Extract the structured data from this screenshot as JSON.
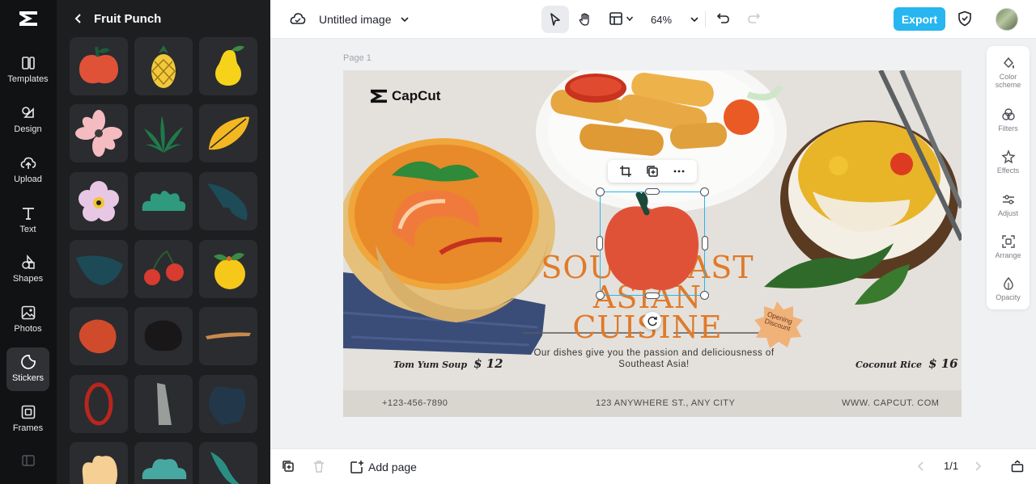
{
  "app": {
    "name": "CapCut"
  },
  "nav": {
    "items": [
      {
        "label": "Templates",
        "icon": "templates-icon",
        "active": false
      },
      {
        "label": "Design",
        "icon": "design-icon",
        "active": false
      },
      {
        "label": "Upload",
        "icon": "upload-icon",
        "active": false
      },
      {
        "label": "Text",
        "icon": "text-icon",
        "active": false
      },
      {
        "label": "Shapes",
        "icon": "shapes-icon",
        "active": false
      },
      {
        "label": "Photos",
        "icon": "photos-icon",
        "active": false
      },
      {
        "label": "Stickers",
        "icon": "stickers-icon",
        "active": true
      },
      {
        "label": "Frames",
        "icon": "frames-icon",
        "active": false
      }
    ]
  },
  "panel": {
    "title": "Fruit Punch",
    "stickers": [
      "apple",
      "pineapple",
      "pear",
      "pink-flower",
      "green-leaves",
      "yellow-leaf",
      "violet-flower",
      "green-bush",
      "teal-leaf",
      "teal-bowl",
      "cherries",
      "lemon",
      "orange-blob",
      "dark-blob",
      "tan-stroke",
      "red-ring",
      "grey-shard",
      "slate-blob",
      "peach-blob",
      "teal-cloud",
      "teal-sprig"
    ]
  },
  "topbar": {
    "doc_title": "Untitled image",
    "zoom": "64%",
    "export_label": "Export",
    "accent": "#27b6ef"
  },
  "canvas": {
    "page_label": "Page 1",
    "design": {
      "brand": "CapCut",
      "headline_line1": "SOUTHEAST ASIAN",
      "headline_line2": "CUISINE",
      "tagline": "Our dishes give you the passion and deliciousness of Southeast Asia!",
      "item1_name": "Tom Yum Soup",
      "item1_price": "$ 12",
      "item2_name": "Coconut Rice",
      "item2_price": "$ 16",
      "badge": "Opening Discount",
      "phone": "+123-456-7890",
      "address": "123 ANYWHERE ST., ANY CITY",
      "website": "WWW. CAPCUT. COM",
      "headline_color": "#e07a2a"
    },
    "selected_sticker": "apple"
  },
  "tools": [
    {
      "label": "Color scheme",
      "icon": "color-scheme-icon"
    },
    {
      "label": "Filters",
      "icon": "filters-icon"
    },
    {
      "label": "Effects",
      "icon": "effects-icon"
    },
    {
      "label": "Adjust",
      "icon": "adjust-icon"
    },
    {
      "label": "Arrange",
      "icon": "arrange-icon"
    },
    {
      "label": "Opacity",
      "icon": "opacity-icon"
    }
  ],
  "bottombar": {
    "add_page_label": "Add page",
    "page_counter": "1/1"
  }
}
